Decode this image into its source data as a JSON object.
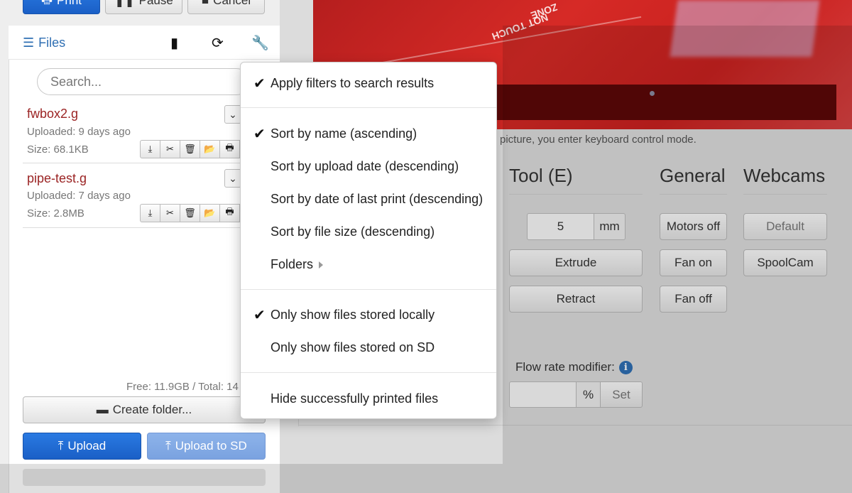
{
  "toolbar": {
    "print_label": "Print",
    "pause_label": "Pause",
    "cancel_label": "Cancel"
  },
  "files_panel": {
    "title": "Files",
    "search_placeholder": "Search...",
    "files": [
      {
        "name": "fwbox2.g",
        "uploaded": "Uploaded: 9 days ago",
        "size": "Size: 68.1KB"
      },
      {
        "name": "pipe-test.g",
        "uploaded": "Uploaded: 7 days ago",
        "size": "Size: 2.8MB"
      }
    ],
    "storage": "Free: 11.9GB / Total: 14",
    "create_folder_label": "Create folder...",
    "upload_label": "Upload",
    "upload_sd_label": "Upload to SD"
  },
  "menu": {
    "items": [
      {
        "label": "Apply filters to search results",
        "checked": true
      },
      {
        "label": "Sort by name (ascending)",
        "checked": true
      },
      {
        "label": "Sort by upload date (descending)",
        "checked": false
      },
      {
        "label": "Sort by date of last print (descending)",
        "checked": false
      },
      {
        "label": "Sort by file size (descending)",
        "checked": false
      },
      {
        "label": "Folders",
        "checked": false
      },
      {
        "label": "Only show files stored locally",
        "checked": true
      },
      {
        "label": "Only show files stored on SD",
        "checked": false
      },
      {
        "label": "Hide successfully printed files",
        "checked": false
      }
    ]
  },
  "control": {
    "hint": "picture, you enter keyboard control mode.",
    "tabs": {
      "tool": "Tool (E)",
      "general": "General",
      "webcams": "Webcams"
    },
    "tool": {
      "amount": "5",
      "unit": "mm",
      "extrude_label": "Extrude",
      "retract_label": "Retract",
      "flow_label": "Flow rate modifier:",
      "flow_unit": "%",
      "flow_set_label": "Set"
    },
    "general": {
      "motors_off_label": "Motors off",
      "fan_on_label": "Fan on",
      "fan_off_label": "Fan off"
    },
    "webcams": {
      "default_label": "Default",
      "spoolcam_label": "SpoolCam"
    }
  },
  "webcam_overlay_text": [
    "ZONE",
    "NOT TOUCH"
  ],
  "colors": {
    "accent_blue": "#1a5fc6",
    "file_name_red": "#9b2424",
    "link_blue": "#2f6fb3",
    "webcam_red": "#c9211f"
  }
}
